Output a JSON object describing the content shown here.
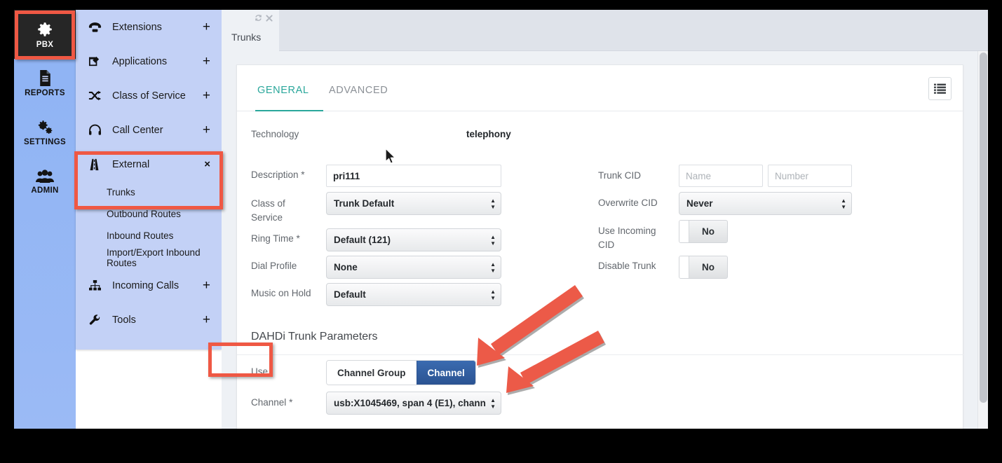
{
  "rail": {
    "items": [
      {
        "label": "PBX",
        "icon": "gear-icon",
        "active": true
      },
      {
        "label": "REPORTS",
        "icon": "document-icon",
        "active": false
      },
      {
        "label": "SETTINGS",
        "icon": "gears-icon",
        "active": false
      },
      {
        "label": "ADMIN",
        "icon": "users-icon",
        "active": false
      }
    ]
  },
  "submenu": {
    "items": [
      {
        "label": "Extensions",
        "icon": "phone-icon",
        "action": "+"
      },
      {
        "label": "Applications",
        "icon": "edit-square-icon",
        "action": "+"
      },
      {
        "label": "Class of Service",
        "icon": "shuffle-icon",
        "action": "+"
      },
      {
        "label": "Call Center",
        "icon": "headset-icon",
        "action": "+"
      },
      {
        "label": "External",
        "icon": "road-icon",
        "action": "×"
      },
      {
        "label": "Incoming Calls",
        "icon": "sitemap-icon",
        "action": "+"
      },
      {
        "label": "Tools",
        "icon": "wrench-icon",
        "action": "+"
      }
    ],
    "external_children": [
      "Trunks",
      "Outbound Routes",
      "Inbound Routes",
      "Import/Export Inbound Routes"
    ]
  },
  "tabbar": {
    "tab_label": "Trunks",
    "refresh_icon": "refresh-icon",
    "close_icon": "close-icon"
  },
  "form": {
    "tabs": {
      "general": "GENERAL",
      "advanced": "ADVANCED"
    },
    "list_button_icon": "list-icon",
    "technology": {
      "label": "Technology",
      "value": "telephony"
    },
    "left_fields": {
      "description": {
        "label": "Description",
        "required": "*",
        "value": "pri111"
      },
      "class_of_service": {
        "label_line1": "Class of",
        "label_line2": "Service",
        "value": "Trunk Default"
      },
      "ring_time": {
        "label": "Ring Time",
        "required": "*",
        "value": "Default (121)"
      },
      "dial_profile": {
        "label": "Dial Profile",
        "value": "None"
      },
      "music_on_hold": {
        "label": "Music on Hold",
        "value": "Default"
      }
    },
    "right_fields": {
      "trunk_cid": {
        "label": "Trunk CID",
        "name_placeholder": "Name",
        "number_placeholder": "Number",
        "name_value": "",
        "number_value": ""
      },
      "overwrite_cid": {
        "label": "Overwrite CID",
        "value": "Never"
      },
      "use_incoming_cid": {
        "label_line1": "Use Incoming",
        "label_line2": "CID",
        "value": "No"
      },
      "disable_trunk": {
        "label": "Disable Trunk",
        "value": "No"
      }
    },
    "dahdi": {
      "title": "DAHDi Trunk Parameters",
      "use": {
        "label": "Use",
        "options": [
          "Channel Group",
          "Channel"
        ],
        "selected": "Channel"
      },
      "channel": {
        "label": "Channel",
        "required": "*",
        "value": "usb:X1045469, span 4 (E1), chann"
      }
    }
  },
  "colors": {
    "accent_teal": "#2aa79b",
    "annotation_red": "#ef5844",
    "active_blue": "#2b5392",
    "rail_active_bg": "#262626",
    "sidebar_bg": "#93b4f0",
    "submenu_bg": "#c3d1f6"
  }
}
